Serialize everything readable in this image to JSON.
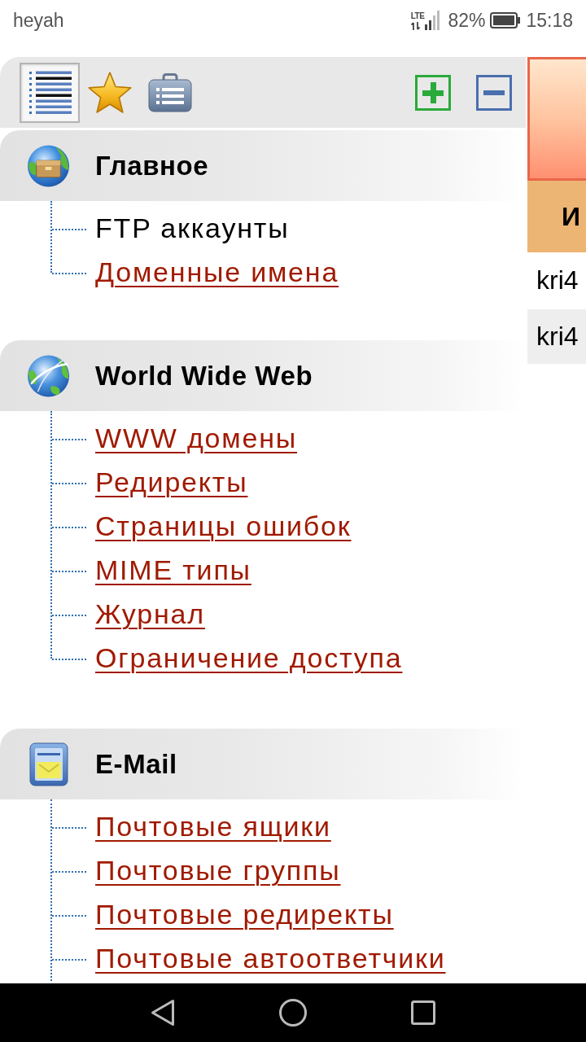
{
  "status_bar": {
    "carrier": "heyah",
    "network": "LTE",
    "battery": "82%",
    "time": "15:18"
  },
  "toolbar": {
    "view_buttons": [
      {
        "kind": "tree",
        "selected": true
      },
      {
        "kind": "favorites",
        "selected": false
      },
      {
        "kind": "services",
        "selected": false
      }
    ]
  },
  "sections": [
    {
      "kind": "main",
      "title": "Главное",
      "items": [
        {
          "label": "FTP аккаунты",
          "selected": true
        },
        {
          "label": "Доменные имена",
          "selected": false
        }
      ]
    },
    {
      "kind": "web",
      "title": "World Wide Web",
      "items": [
        {
          "label": "WWW домены",
          "selected": false
        },
        {
          "label": "Редиректы",
          "selected": false
        },
        {
          "label": "Страницы ошибок",
          "selected": false
        },
        {
          "label": "MIME типы",
          "selected": false
        },
        {
          "label": "Журнал",
          "selected": false
        },
        {
          "label": "Ограничение доступа",
          "selected": false
        }
      ]
    },
    {
      "kind": "mail",
      "title": "E-Mail",
      "items": [
        {
          "label": "Почтовые ящики",
          "selected": false
        },
        {
          "label": "Почтовые группы",
          "selected": false
        },
        {
          "label": "Почтовые редиректы",
          "selected": false
        },
        {
          "label": "Почтовые автоответчики",
          "selected": false
        }
      ]
    }
  ],
  "right_panel": {
    "column_header": "И",
    "rows": [
      "kri4",
      "kri4"
    ]
  }
}
